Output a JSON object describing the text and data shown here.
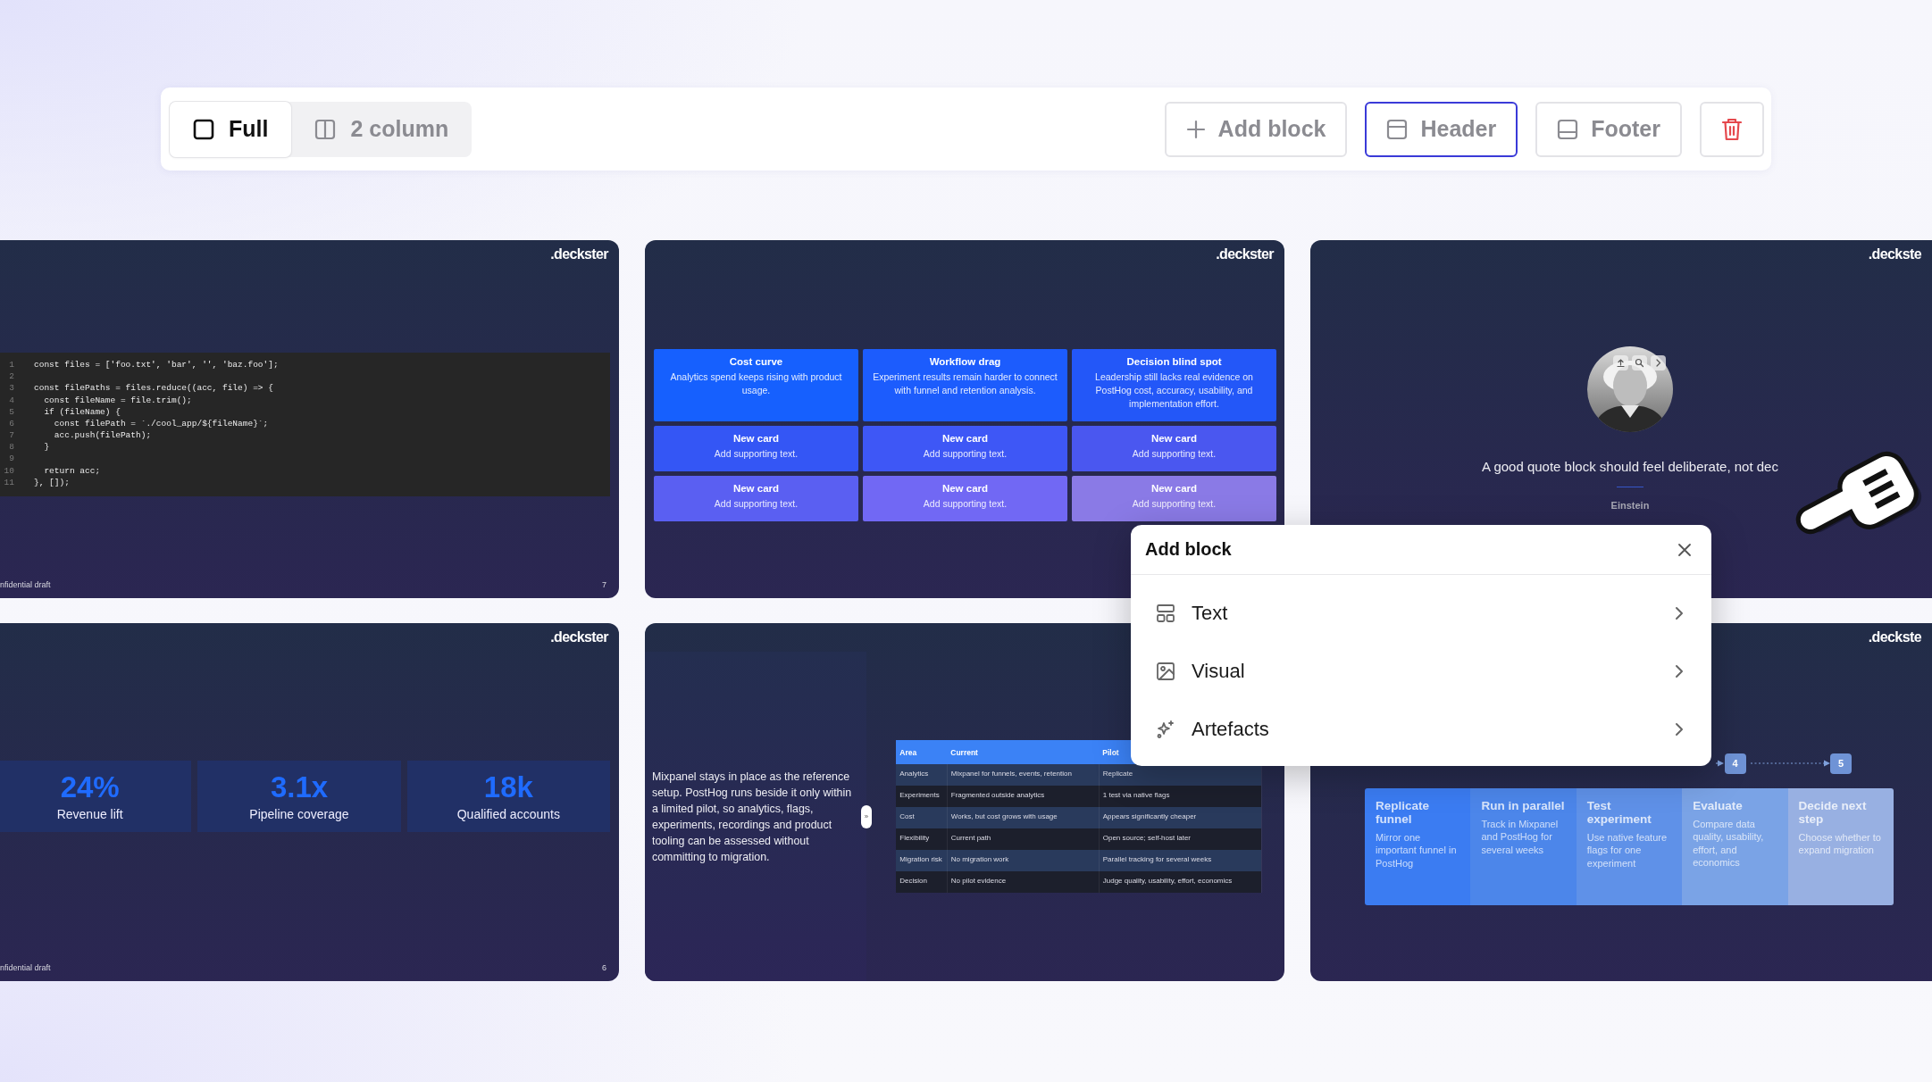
{
  "toolbar": {
    "layouts": [
      {
        "kind": "full",
        "label": "Full",
        "selected": true
      },
      {
        "kind": "columns",
        "label": "2 column",
        "selected": false
      }
    ],
    "actions": [
      {
        "kind": "add",
        "label": "Add block",
        "selected": false
      },
      {
        "kind": "header",
        "label": "Header",
        "selected": true
      },
      {
        "kind": "footer",
        "label": "Footer",
        "selected": false
      },
      {
        "kind": "delete",
        "selected": false
      }
    ]
  },
  "slides": [
    {
      "kind": "code",
      "logo": ".deckster",
      "lines": [
        {
          "n": "1",
          "code": "const files = ['foo.txt', 'bar', '', 'baz.foo'];"
        },
        {
          "n": "2"
        },
        {
          "n": "3",
          "code": "const filePaths = files.reduce((acc, file) => {"
        },
        {
          "n": "4",
          "code": "  const fileName = file.trim();"
        },
        {
          "n": "5",
          "code": "  if (fileName) {"
        },
        {
          "n": "6",
          "code": "    const filePath = `./cool_app/${fileName}`;"
        },
        {
          "n": "7",
          "code": "    acc.push(filePath);"
        },
        {
          "n": "8",
          "code": "  }"
        },
        {
          "n": "9"
        },
        {
          "n": "10",
          "code": "  return acc;"
        },
        {
          "n": "11",
          "code": "}, []);"
        }
      ],
      "footer": "nfidential draft",
      "page": "7"
    },
    {
      "kind": "cards",
      "logo": ".deckster",
      "cards": [
        {
          "title": "Cost curve",
          "text": "Analytics spend keeps rising with product usage.",
          "color": "#1660fe"
        },
        {
          "title": "Workflow drag",
          "text": "Experiment results remain harder to connect with funnel and retention analysis.",
          "color": "#1c5cfd"
        },
        {
          "title": "Decision blind spot",
          "text": "Leadership still lacks real evidence on PostHog cost, accuracy, usability, and implementation effort.",
          "color": "#2357f8"
        },
        {
          "title": "New card",
          "text": "Add supporting text.",
          "color": "#3456f5"
        },
        {
          "title": "New card",
          "text": "Add supporting text.",
          "color": "#3e57f6"
        },
        {
          "title": "New card",
          "text": "Add supporting text.",
          "color": "#4a57f0"
        },
        {
          "title": "New card",
          "text": "Add supporting text.",
          "color": "#5a5ff2"
        },
        {
          "title": "New card",
          "text": "Add supporting text.",
          "color": "#7168f4"
        },
        {
          "title": "New card",
          "text": "Add supporting text.",
          "color": "#8a7ae6"
        }
      ]
    },
    {
      "kind": "quote",
      "logo": ".deckste",
      "quote": "A good quote block should feel deliberate, not dec",
      "author": "Einstein"
    },
    {
      "kind": "stats",
      "logo": ".deckster",
      "stats": [
        {
          "value": "24%",
          "label": "Revenue lift"
        },
        {
          "value": "3.1x",
          "label": "Pipeline coverage"
        },
        {
          "value": "18k",
          "label": "Qualified accounts"
        }
      ],
      "footer": "nfidential draft",
      "page": "6"
    },
    {
      "kind": "table",
      "text": "Mixpanel stays in place as the reference setup. PostHog runs beside it only within a limited pilot, so analytics, flags, experiments, recordings and product tooling can be assessed without committing to migration.",
      "handle": "»",
      "columns": [
        "Area",
        "Current",
        "Pilot"
      ],
      "rows": [
        [
          "Analytics",
          "Mixpanel for funnels, events, retention",
          "Replicate"
        ],
        [
          "Experiments",
          "Fragmented outside analytics",
          "1 test via native flags"
        ],
        [
          "Cost",
          "Works, but cost grows with usage",
          "Appears significantly cheaper"
        ],
        [
          "Flexibility",
          "Current path",
          "Open source; self-host later"
        ],
        [
          "Migration risk",
          "No migration work",
          "Parallel tracking for several weeks"
        ],
        [
          "Decision",
          "No pilot evidence",
          "Judge quality, usability, effort, economics"
        ]
      ]
    },
    {
      "kind": "steps",
      "logo": ".deckste",
      "steps": [
        {
          "title": "Replicate funnel",
          "text": "Mirror one important funnel in PostHog",
          "color": "#3b7cf2"
        },
        {
          "title": "Run in parallel",
          "text": "Track in Mixpanel and PostHog for several weeks",
          "color": "#4c86ea"
        },
        {
          "title": "Test experiment",
          "text": "Use native feature flags for one experiment",
          "color": "#5f91e8"
        },
        {
          "title": "Evaluate",
          "text": "Compare data quality, usability, effort, and economics",
          "color": "#7aa3e6",
          "marker": "4"
        },
        {
          "title": "Decide next step",
          "text": "Choose whether to expand migration",
          "color": "#98b0e2",
          "marker": "5"
        }
      ]
    }
  ],
  "popup": {
    "title": "Add block",
    "items": [
      {
        "kind": "text",
        "label": "Text"
      },
      {
        "kind": "visual",
        "label": "Visual"
      },
      {
        "kind": "artefacts",
        "label": "Artefacts"
      }
    ]
  }
}
